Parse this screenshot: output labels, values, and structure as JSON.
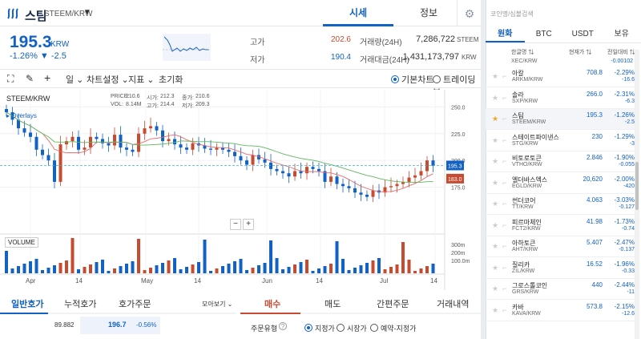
{
  "header": {
    "coin_name": "스팀",
    "pair": "STEEM/KRW",
    "tabs": [
      "시세",
      "정보"
    ]
  },
  "price": {
    "current": "195.3",
    "unit": "KRW",
    "change": "-1.26% ▼ -2.5",
    "high_label": "고가",
    "high": "202.6",
    "low_label": "저가",
    "low": "190.4",
    "volume_label": "거래량(24H)",
    "volume": "7,286,722",
    "volume_unit": "STEEM",
    "amount_label": "거래대금(24H)",
    "amount": "1,431,173,797",
    "amount_unit": "KRW"
  },
  "toolbar": {
    "interval": "일 ⌄",
    "chart_settings": "차트설정 ⌄",
    "indicators": "지표 ⌄",
    "reset": "초기화",
    "basic_chart": "기본차트",
    "trading_view": "트레이딩뷰"
  },
  "chart": {
    "pair": "STEEM/KRW",
    "ohlc_labels": [
      "PRICE:",
      "VOL:",
      "시가:",
      "고가:",
      "종가:",
      "저가:"
    ],
    "ohlc_values": [
      "210.6",
      "8.14M",
      "212.3",
      "214.4",
      "210.6",
      "209.3"
    ],
    "overlays": "Overlays",
    "volume_label": "VOLUME",
    "price_ticks": [
      "250.0",
      "225.0",
      "200.0",
      "175.0"
    ],
    "volume_ticks": [
      "300m",
      "200m",
      "100.0m"
    ],
    "x_ticks": [
      "Apr",
      "14",
      "May",
      "14",
      "Jun",
      "14",
      "Jul",
      "14"
    ],
    "current_price_tag": "195.3",
    "ma_price_tag": "183.0",
    "zoom_out": "−",
    "zoom_in": "+"
  },
  "chart_data": {
    "type": "candlestick",
    "ylim": [
      150,
      260
    ],
    "candles_close": [
      245,
      238,
      230,
      226,
      222,
      210,
      205,
      200,
      180,
      215,
      218,
      222,
      210,
      212,
      222,
      220,
      216,
      214,
      224,
      212,
      210,
      208,
      225,
      230,
      232,
      228,
      218,
      220,
      215,
      212,
      210,
      216,
      214,
      211,
      210,
      212,
      210,
      208,
      204,
      200,
      196,
      205,
      201,
      198,
      192,
      190,
      188,
      185,
      190,
      188,
      194,
      192,
      190,
      180,
      185,
      178,
      176,
      174,
      170,
      168,
      166,
      172,
      170,
      175,
      176,
      178,
      180,
      184,
      186,
      190,
      200,
      195
    ]
  },
  "bottom": {
    "left_tabs": [
      "일반호가",
      "누적호가",
      "호가주문"
    ],
    "view_all": "모아보기 ⌄",
    "order_tabs": [
      "매수",
      "매도",
      "간편주문",
      "거래내역"
    ],
    "order_book_row": [
      "89.882",
      "196.7",
      "-0.56%"
    ],
    "order_type_label": "주문유형",
    "order_types": [
      "지정가",
      "시장가",
      "예약-지정가"
    ]
  },
  "side": {
    "search_placeholder": "코인명/심볼검색",
    "tabs": [
      "원화",
      "BTC",
      "USDT",
      "보유"
    ],
    "col_headers": [
      "한글명 ⇅",
      "현재가 ⇅",
      "전일대비 ⇅"
    ],
    "rows": [
      {
        "kr": "아칼",
        "en": "ARKM/KRW",
        "price": "708.8",
        "pct": "-2.29%",
        "diff": "-16.6"
      },
      {
        "kr": "솔라",
        "en": "SXP/KRW",
        "price": "266.0",
        "pct": "-2.31%",
        "diff": "-6.3"
      },
      {
        "kr": "스팀",
        "en": "STEEM/KRW",
        "price": "195.3",
        "pct": "-1.26%",
        "diff": "-2.5"
      },
      {
        "kr": "스테이트파이낸스",
        "en": "STG/KRW",
        "price": "230",
        "pct": "-1.29%",
        "diff": "-3"
      },
      {
        "kr": "비토로토큰",
        "en": "VTHO/KRW",
        "price": "2.846",
        "pct": "-1.90%",
        "diff": "-0.055"
      },
      {
        "kr": "엘더바스엑스",
        "en": "EGLD/KRW",
        "price": "20,620",
        "pct": "-2.00%",
        "diff": "-420"
      },
      {
        "kr": "썬더코어",
        "en": "TT/KRW",
        "price": "4.063",
        "pct": "-3.03%",
        "diff": "-0.127"
      },
      {
        "kr": "피르마체인",
        "en": "FCT2/KRW",
        "price": "41.98",
        "pct": "-1.73%",
        "diff": "-0.74"
      },
      {
        "kr": "아하토큰",
        "en": "AHT/KRW",
        "price": "5.407",
        "pct": "-2.47%",
        "diff": "-0.137"
      },
      {
        "kr": "질리카",
        "en": "ZIL/KRW",
        "price": "16.52",
        "pct": "-1.96%",
        "diff": "-0.33"
      },
      {
        "kr": "그로스톨코인",
        "en": "GRS/KRW",
        "price": "440",
        "pct": "-2.44%",
        "diff": "-11"
      },
      {
        "kr": "카바",
        "en": "KAVA/KRW",
        "price": "573.8",
        "pct": "-2.15%",
        "diff": "-12.6"
      }
    ],
    "top_partial": {
      "en": "XEC/KRW",
      "diff": "-0.00102"
    }
  }
}
